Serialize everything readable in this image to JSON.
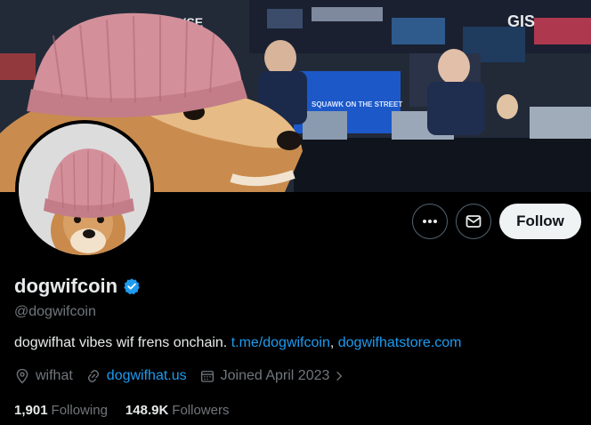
{
  "banner": {
    "sign_text_1": "NYSE",
    "sign_text_2": "GIS",
    "desk_text": "SQUAWK ON THE STREET"
  },
  "actions": {
    "more_icon": "more-dots-icon",
    "message_icon": "envelope-icon",
    "follow_label": "Follow"
  },
  "profile": {
    "display_name": "dogwifcoin",
    "verified_icon": "verified-badge-icon",
    "handle": "@dogwifcoin",
    "bio_text": "dogwifhat vibes wif frens onchain. ",
    "bio_link_1": "t.me/dogwifcoin",
    "bio_separator": ", ",
    "bio_link_2": "dogwifhatstore.com",
    "location": "wifhat",
    "website": "dogwifhat.us",
    "joined": "Joined April 2023"
  },
  "stats": {
    "following_count": "1,901",
    "following_label": "Following",
    "followers_count": "148.9K",
    "followers_label": "Followers"
  },
  "colors": {
    "accent": "#1d9bf0",
    "background": "#000000",
    "muted": "#71767b"
  }
}
